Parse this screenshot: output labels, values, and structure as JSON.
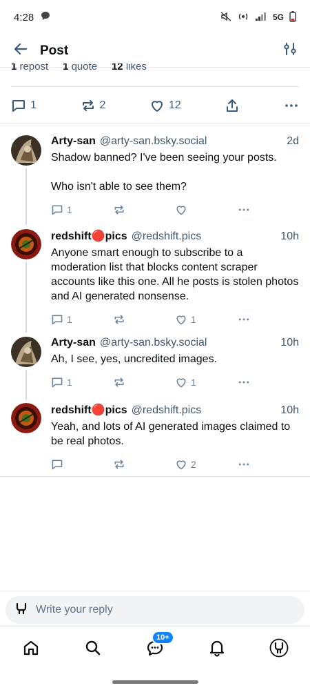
{
  "status_bar": {
    "time": "4:28",
    "network": "5G"
  },
  "header": {
    "title": "Post"
  },
  "stats": {
    "reposts": "1",
    "reposts_label": "repost",
    "quotes": "1",
    "quotes_label": "quote",
    "likes": "12",
    "likes_label": "likes"
  },
  "main_actions": {
    "replies": "1",
    "reposts": "2",
    "likes": "12"
  },
  "replies": [
    {
      "name": "Arty-san",
      "handle": "@arty-san.bsky.social",
      "time": "2d",
      "text": "Shadow banned? I've been seeing your posts.\n\nWho isn't able to see them?",
      "reply_count": "1",
      "repost_count": "",
      "like_count": ""
    },
    {
      "name": "redshift🔴pics",
      "handle": "@redshift.pics",
      "time": "10h",
      "text": "Anyone smart enough to subscribe to a moderation list that blocks content scraper accounts like this one. All he posts is stolen photos and AI generated nonsense.",
      "reply_count": "1",
      "repost_count": "",
      "like_count": "1"
    },
    {
      "name": "Arty-san",
      "handle": "@arty-san.bsky.social",
      "time": "10h",
      "text": "Ah, I see, yes, uncredited images.",
      "reply_count": "1",
      "repost_count": "",
      "like_count": "1"
    },
    {
      "name": "redshift🔴pics",
      "handle": "@redshift.pics",
      "time": "10h",
      "text": "Yeah, and lots of AI generated images claimed to be real photos.",
      "reply_count": "",
      "repost_count": "",
      "like_count": "2"
    }
  ],
  "composer": {
    "placeholder": "Write your reply"
  },
  "tabbar": {
    "notifications_badge": "10+"
  },
  "colors": {
    "accent": "#1083fe",
    "muted": "#42576c"
  }
}
